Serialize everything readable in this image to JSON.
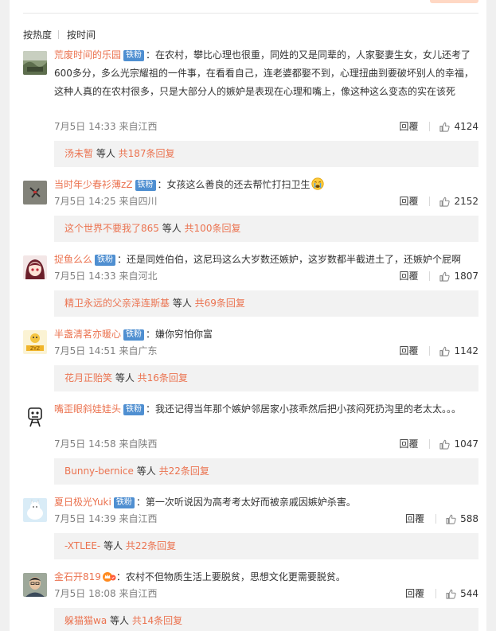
{
  "sort": {
    "hot_label": "按热度",
    "time_label": "按时间"
  },
  "badge_label": "铁粉",
  "like_icon": "thumbs-up-icon",
  "comments": [
    {
      "user": "荒废时间的乐园",
      "text": "：在农村，攀比心理也很重，同姓的又是同辈的，人家娶妻生女，女儿还考了600多分，多么光宗耀祖的一件事，在看看自己，连老婆都娶不到，心理扭曲到要破坏别人的幸福，这种人真的在农村很多，只是大部分人的嫉妒是表现在心理和嘴上，像这种这么变态的实在该死",
      "time": "7月5日 14:33 来自江西",
      "reply": "回覆",
      "likes": "4124",
      "sub_user": "汤未暂",
      "sub_mid": " 等人 ",
      "sub_count": "共187条回复"
    },
    {
      "user": "当时年少春衫薄zZ",
      "text": "：女孩这么善良的还去帮忙打扫卫生",
      "emoji": "crying-face-emoji",
      "time": "7月5日 14:25 来自四川",
      "reply": "回覆",
      "likes": "2152",
      "sub_user": "这个世界不要我了865",
      "sub_mid": " 等人 ",
      "sub_count": "共100条回复"
    },
    {
      "user": "捉鱼么么",
      "text": "：还是同姓伯伯，这尼玛这么大岁数还嫉妒，这岁数都半截进土了，还嫉妒个屁啊",
      "time": "7月5日 14:33 来自河北",
      "reply": "回覆",
      "likes": "1807",
      "sub_user": "精卫永远的父亲泽连斯基",
      "sub_mid": " 等人 ",
      "sub_count": "共69条回复"
    },
    {
      "user": "半盏清茗亦暖心",
      "text": "：嫌你穷怕你富",
      "time": "7月5日 14:51 来自广东",
      "reply": "回覆",
      "likes": "1142",
      "sub_user": "花月正贻笑",
      "sub_mid": " 等人 ",
      "sub_count": "共16条回复"
    },
    {
      "user": "嘴歪眼斜娃娃头",
      "text": "：我还记得当年那个嫉妒邻居家小孩乖然后把小孩闷死扔沟里的老太太。。。",
      "time": "7月5日 14:58 来自陕西",
      "reply": "回覆",
      "likes": "1047",
      "sub_user": "Bunny-bernice",
      "sub_mid": " 等人 ",
      "sub_count": "共22条回复"
    },
    {
      "user": "夏日极光Yuki",
      "text": "：第一次听说因为高考考太好而被亲戚因嫉妒杀害。",
      "time": "7月5日 14:39 来自江西",
      "reply": "回覆",
      "likes": "588",
      "sub_user": "-XTLEE-",
      "sub_mid": " 等人 ",
      "sub_count": "共22条回复"
    },
    {
      "user": "金石开819",
      "text": "：农村不但物质生活上要脱贫，思想文化更需要脱贫。",
      "crown": "crown-badge-icon",
      "time": "7月5日 18:08 来自江西",
      "reply": "回覆",
      "likes": "544",
      "sub_user": "躲猫猫wa",
      "sub_mid": " 等人 ",
      "sub_count": "共14条回复"
    }
  ],
  "colors": {
    "username": "#eb7350",
    "badge": "#4f8fd1",
    "sub_bg": "#f2f2f2",
    "meta": "#808080"
  }
}
